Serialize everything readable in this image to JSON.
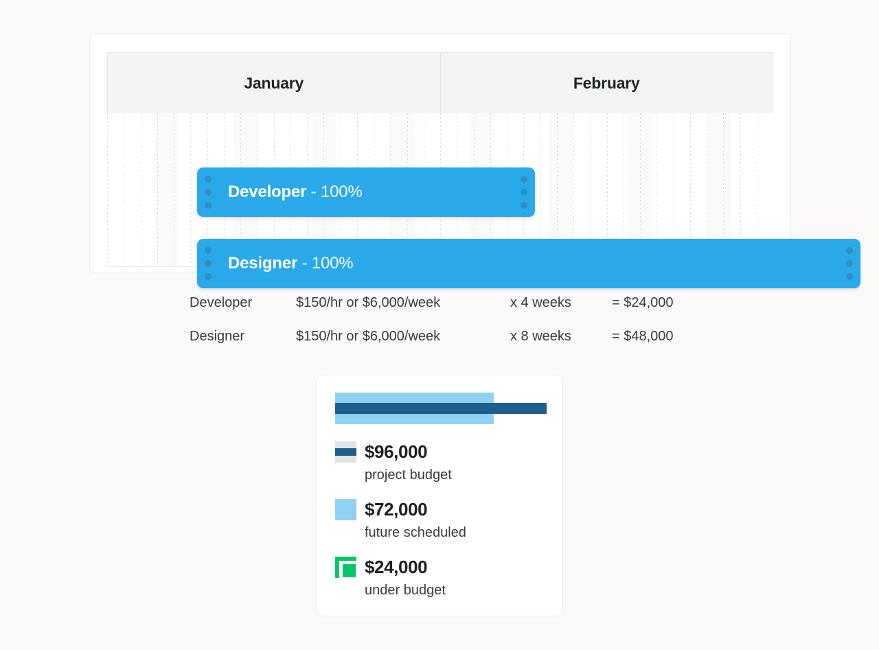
{
  "gantt": {
    "months": [
      {
        "label": "January"
      },
      {
        "label": "February"
      }
    ],
    "tasks": [
      {
        "id": "developer",
        "role": "Developer",
        "allocation": "- 100%",
        "handle_icon": "drag-handle-dots-icon"
      },
      {
        "id": "designer",
        "role": "Designer",
        "allocation": "- 100%",
        "handle_icon": "drag-handle-dots-icon"
      }
    ]
  },
  "rates": {
    "rows": [
      {
        "role": "Developer",
        "rate": "$150/hr or $6,000/week",
        "duration": "x 4 weeks",
        "total": "= $24,000"
      },
      {
        "role": "Designer",
        "rate": "$150/hr or $6,000/week",
        "duration": "x 8 weeks",
        "total": "= $48,000"
      }
    ]
  },
  "budget": {
    "legend": [
      {
        "amount": "$96,000",
        "caption": "project budget",
        "swatch": "budget-line-swatch",
        "color": "#1d5e8e"
      },
      {
        "amount": "$72,000",
        "caption": "future scheduled",
        "swatch": "future-fill-swatch",
        "color": "#8fd1f2"
      },
      {
        "amount": "$24,000",
        "caption": "under budget",
        "swatch": "under-budget-swatch",
        "color": "#00c767"
      }
    ]
  },
  "chart_data": {
    "type": "bar",
    "title": "",
    "orientation": "horizontal",
    "categories": [
      "future scheduled",
      "project budget"
    ],
    "series": [
      {
        "name": "future scheduled",
        "values": [
          72000
        ],
        "color": "#8fd1f2"
      },
      {
        "name": "project budget",
        "values": [
          96000
        ],
        "color": "#1d5e8e"
      }
    ],
    "annotations": [
      {
        "label": "under budget",
        "value": 24000,
        "color": "#00c767"
      }
    ],
    "xlim": [
      0,
      96000
    ],
    "xlabel": "",
    "ylabel": "",
    "grid": false,
    "legend_position": "below",
    "bar_pct": {
      "future_scheduled": 75,
      "project_budget": 100
    }
  },
  "theme": {
    "page_bg": "#faf9f7",
    "card_bg": "#ffffff",
    "task_bar": "#29a9e9",
    "task_handle": "#2b8ec4",
    "budget_dark": "#1d5e8e",
    "budget_light": "#8fd1f2",
    "under_budget": "#00c767"
  }
}
